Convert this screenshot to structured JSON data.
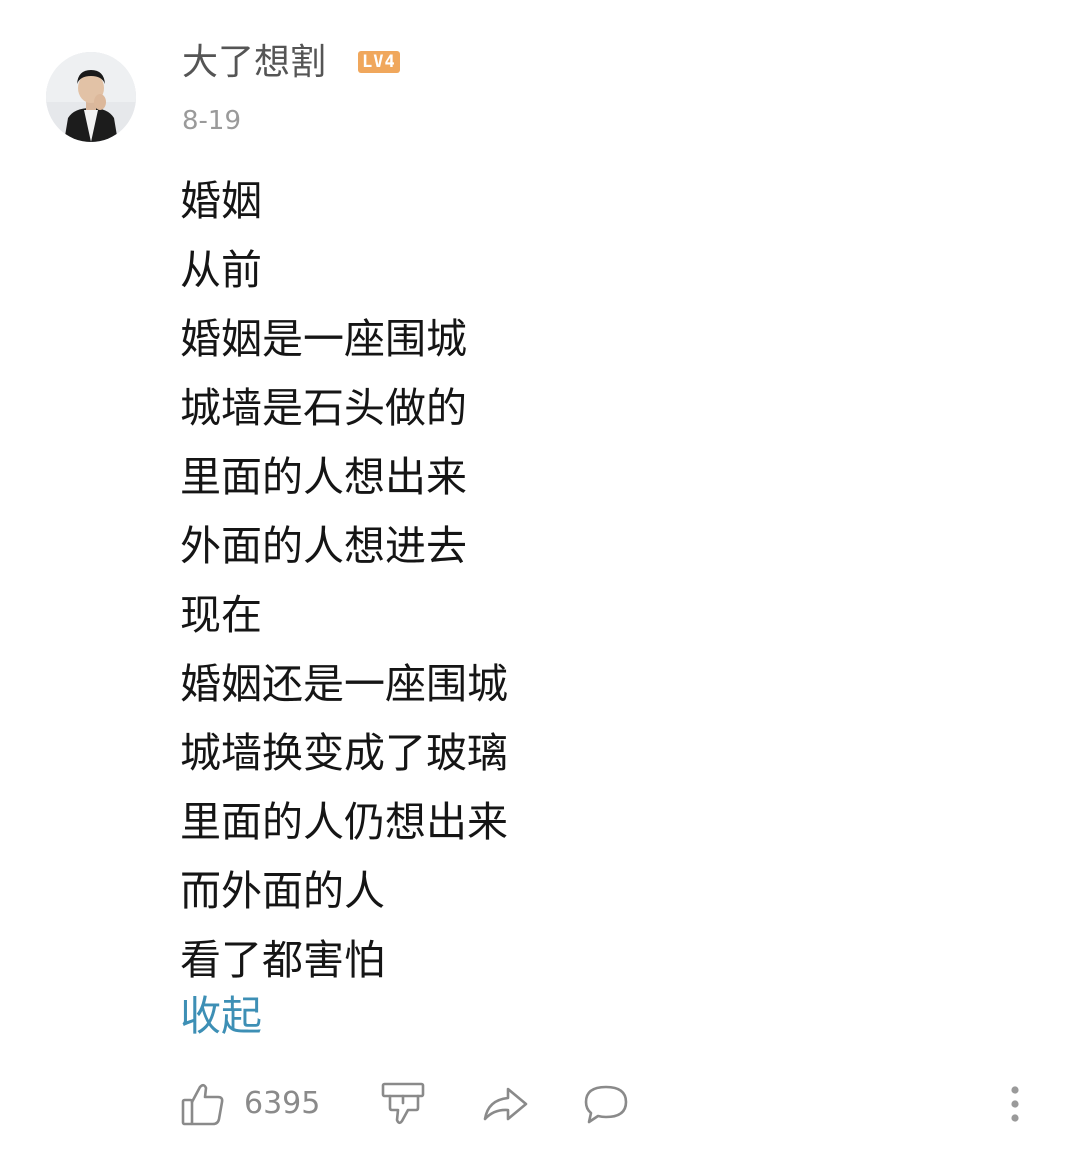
{
  "comment": {
    "username": "大了想割",
    "level_badge": "LV4",
    "timestamp": "8-19",
    "body_lines": [
      "婚姻",
      "从前",
      "婚姻是一座围城",
      "城墙是石头做的",
      "里面的人想出来",
      "外面的人想进去",
      "现在",
      "婚姻还是一座围城",
      "城墙换变成了玻璃",
      "里面的人仍想出来",
      "而外面的人",
      "看了都害怕"
    ],
    "collapse_label": "收起"
  },
  "actions": {
    "like_count": "6395",
    "icons": [
      "thumbs-up-icon",
      "thumbs-down-icon",
      "share-icon",
      "reply-icon",
      "more-icon"
    ]
  },
  "colors": {
    "link": "#3d8fb5",
    "badge": "#f0a75c",
    "muted": "#9a9a9a"
  }
}
